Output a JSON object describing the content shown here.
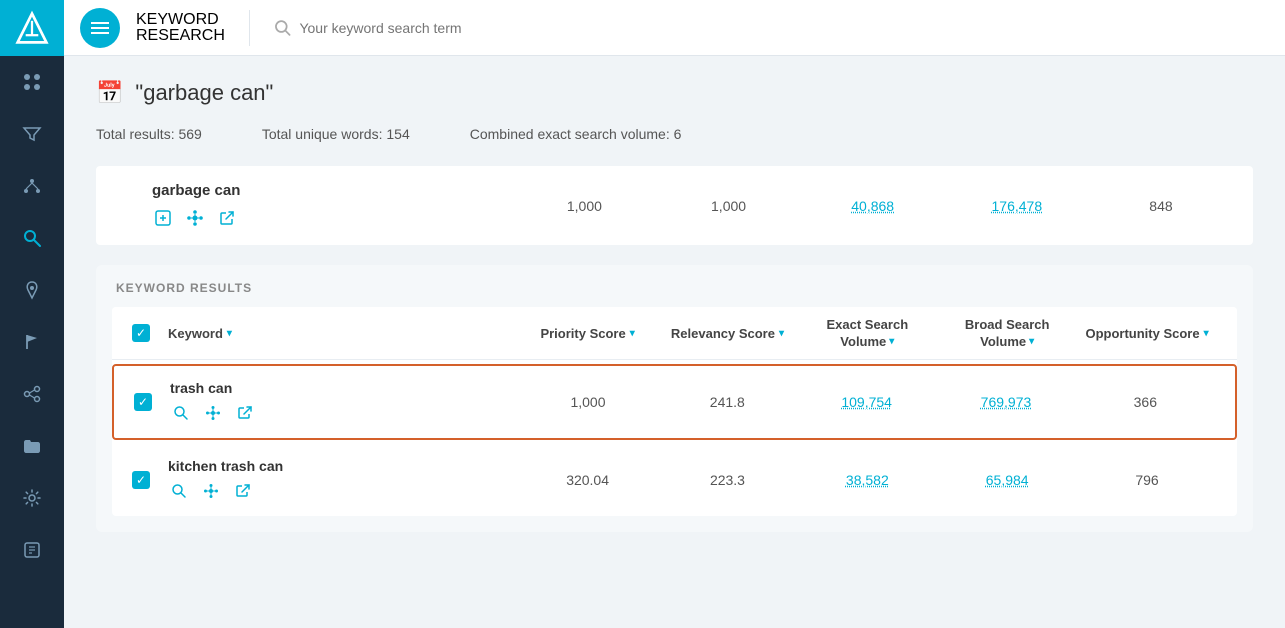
{
  "sidebar": {
    "icons": [
      {
        "name": "dashboard-icon",
        "symbol": "⊞"
      },
      {
        "name": "funnel-icon",
        "symbol": "⊟"
      },
      {
        "name": "nodes-icon",
        "symbol": "✦"
      },
      {
        "name": "search-icon",
        "symbol": "🔍"
      },
      {
        "name": "rocket-icon",
        "symbol": "🚀"
      },
      {
        "name": "flag-icon",
        "symbol": "⚑"
      },
      {
        "name": "network-icon",
        "symbol": "⋈"
      },
      {
        "name": "folder-icon",
        "symbol": "📁"
      },
      {
        "name": "settings-icon",
        "symbol": "⚙"
      },
      {
        "name": "export-icon",
        "symbol": "📋"
      }
    ]
  },
  "header": {
    "menu_button_label": "≡",
    "brand_line1": "KEYWORD",
    "brand_line2": "RESEARCH",
    "search_placeholder": "Your keyword search term"
  },
  "page": {
    "title": "\"garbage can\"",
    "title_icon": "📅",
    "stats": {
      "total_results_label": "Total results:",
      "total_results_value": "569",
      "total_unique_words_label": "Total unique words:",
      "total_unique_words_value": "154",
      "combined_search_label": "Combined exact search volume:",
      "combined_search_value": "6"
    }
  },
  "seed_keyword": {
    "name": "garbage can",
    "metric1": "1,000",
    "metric2": "1,000",
    "metric3": "40,868",
    "metric4": "176,478",
    "metric5": "848"
  },
  "keyword_results": {
    "section_label": "KEYWORD RESULTS",
    "columns": {
      "keyword": "Keyword",
      "priority_score": "Priority Score",
      "relevancy_score": "Relevancy Score",
      "exact_search_volume": "Exact Search Volume",
      "broad_search_volume": "Broad Search Volume",
      "opportunity_score": "Opportunity Score"
    },
    "rows": [
      {
        "name": "trash can",
        "priority_score": "1,000",
        "relevancy_score": "241.8",
        "exact_search_volume": "109,754",
        "broad_search_volume": "769,973",
        "opportunity_score": "366",
        "highlighted": true
      },
      {
        "name": "kitchen trash can",
        "priority_score": "320.04",
        "relevancy_score": "223.3",
        "exact_search_volume": "38,582",
        "broad_search_volume": "65,984",
        "opportunity_score": "796",
        "highlighted": false
      }
    ]
  }
}
